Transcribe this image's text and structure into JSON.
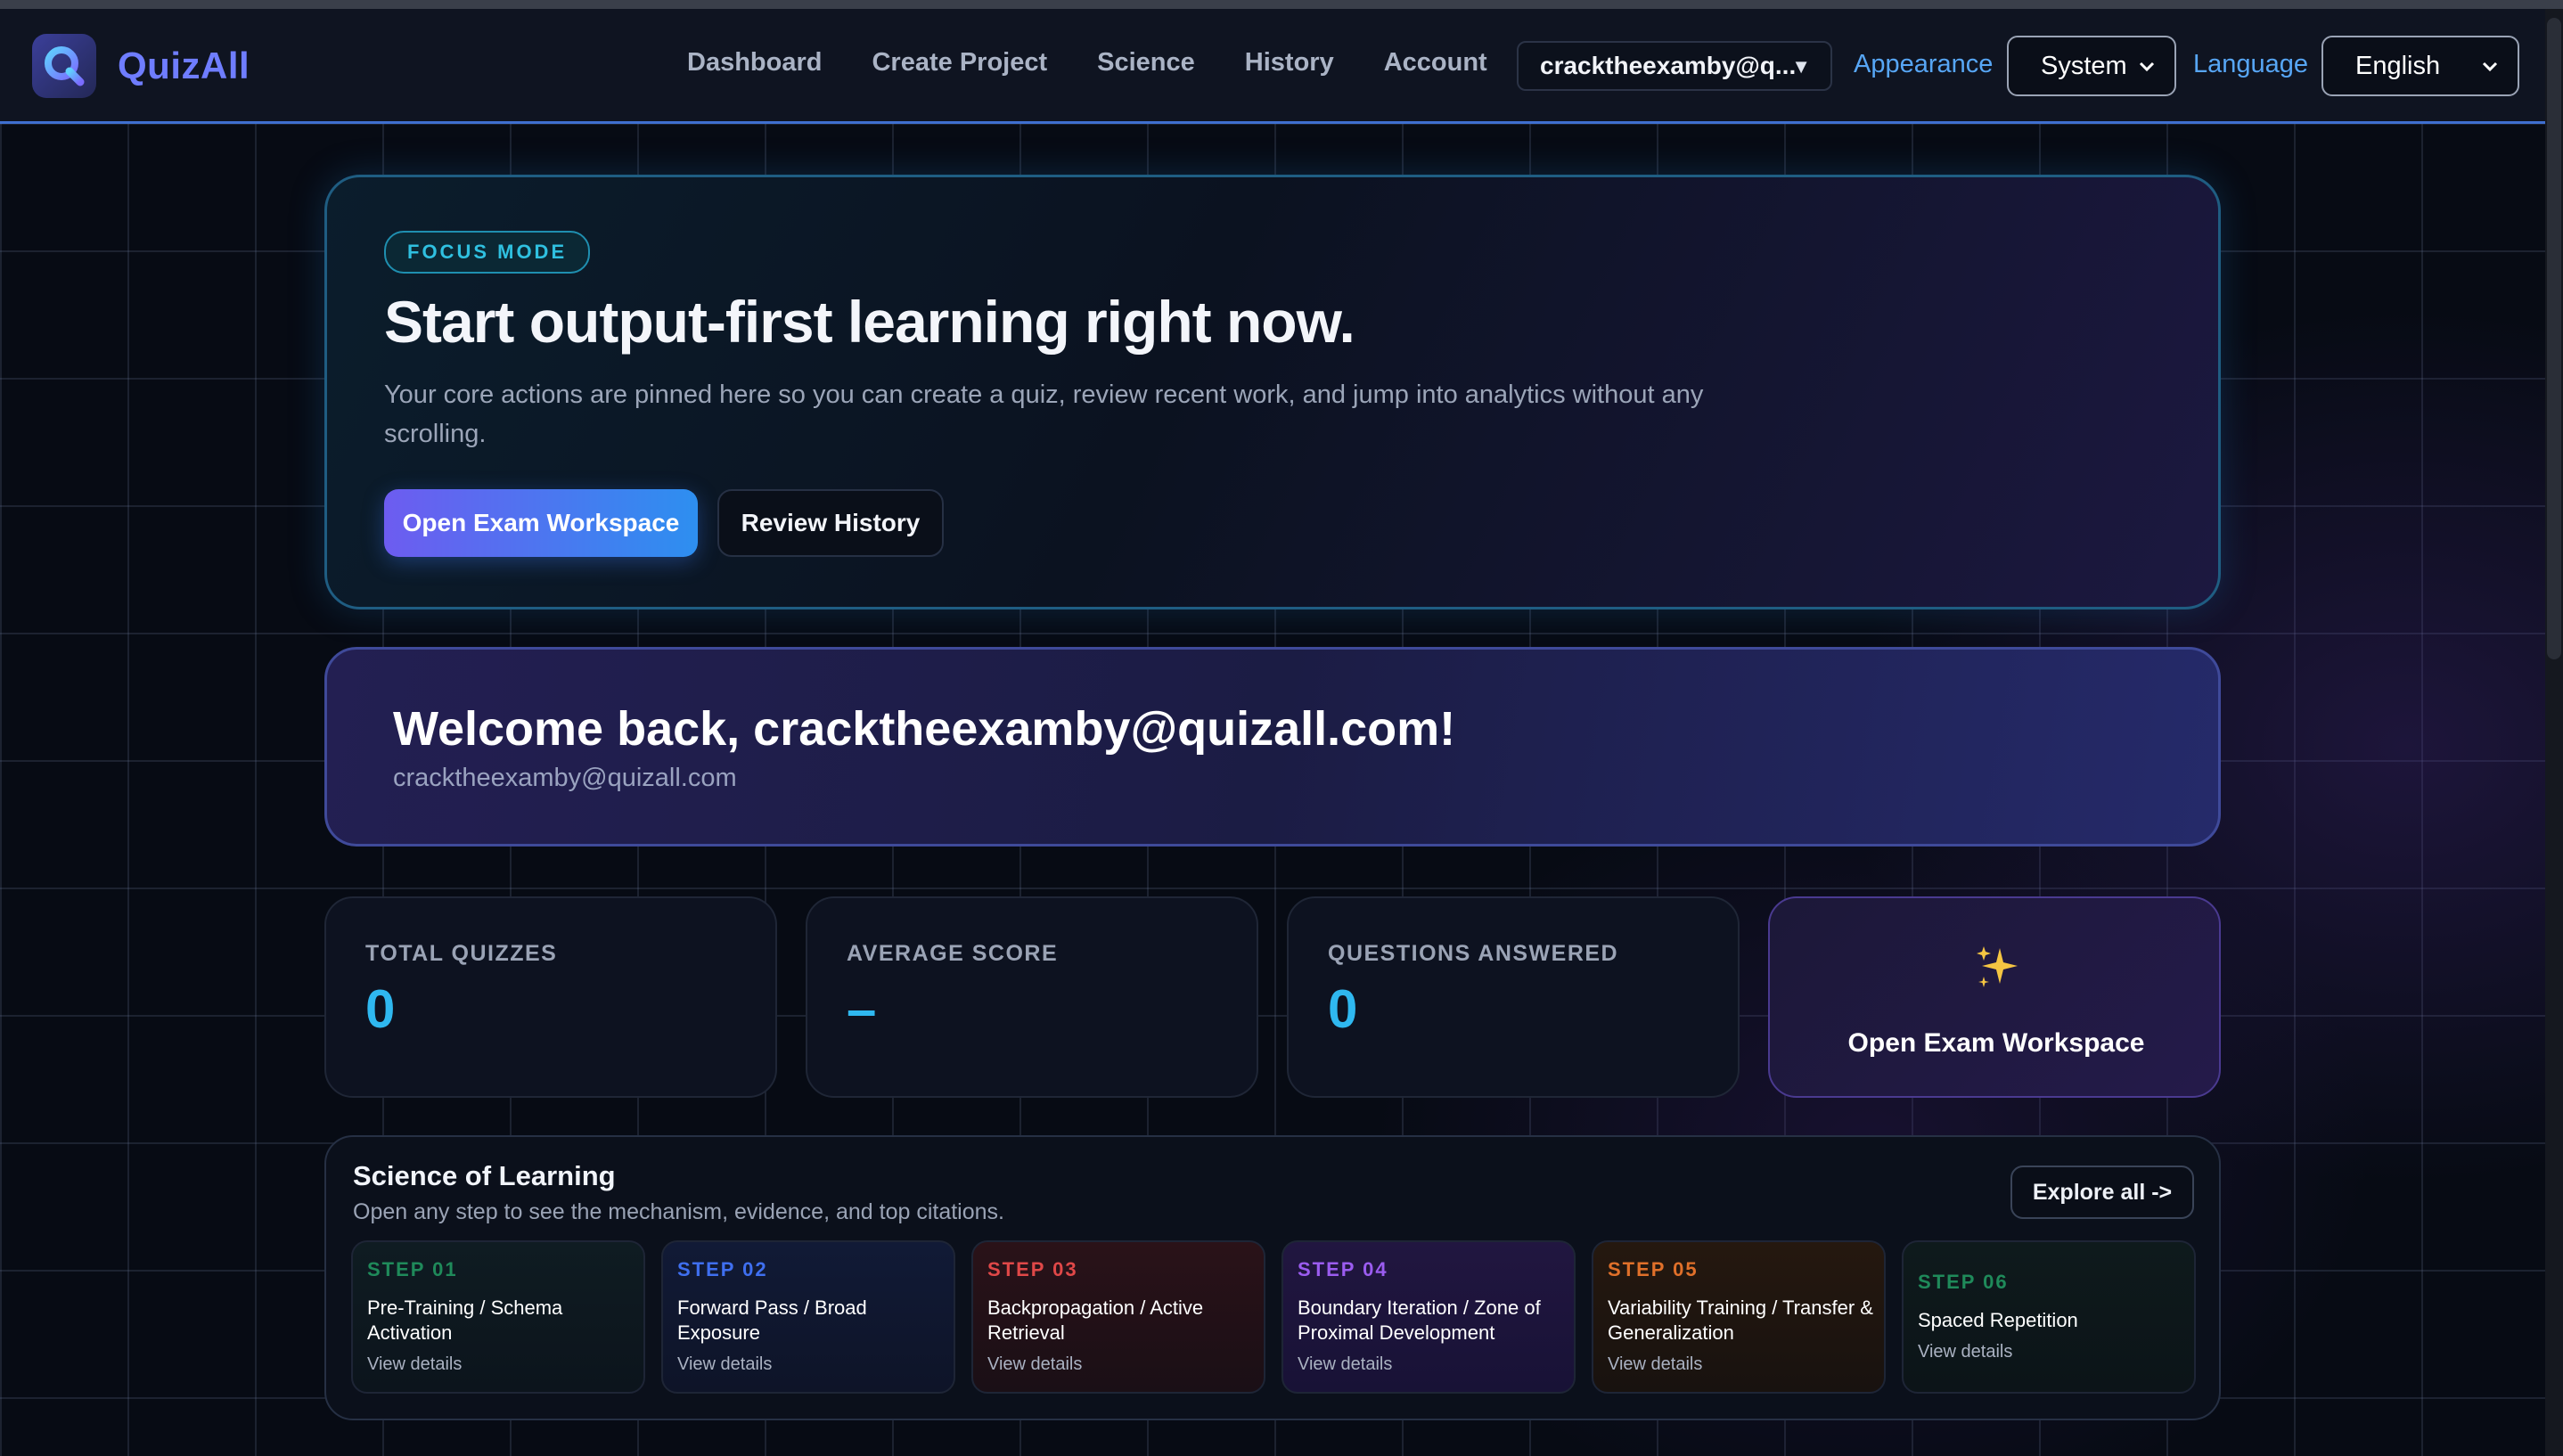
{
  "app": {
    "name": "QuizAll"
  },
  "nav": {
    "items": [
      {
        "label": "Dashboard"
      },
      {
        "label": "Create Project"
      },
      {
        "label": "Science"
      },
      {
        "label": "History"
      },
      {
        "label": "Account"
      }
    ]
  },
  "header": {
    "user_select": "cracktheexamby@q...",
    "appearance_label": "Appearance",
    "appearance_value": "System",
    "language_label": "Language",
    "language_value": "English"
  },
  "hero": {
    "badge": "FOCUS MODE",
    "title": "Start output-first learning right now.",
    "description": "Your core actions are pinned here so you can create a quiz, review recent work, and jump into analytics without any scrolling.",
    "primary_button": "Open Exam Workspace",
    "secondary_button": "Review History"
  },
  "welcome": {
    "title": "Welcome back, cracktheexamby@quizall.com!",
    "email": "cracktheexamby@quizall.com"
  },
  "stats": [
    {
      "label": "TOTAL QUIZZES",
      "value": "0"
    },
    {
      "label": "AVERAGE SCORE",
      "value": "–"
    },
    {
      "label": "QUESTIONS ANSWERED",
      "value": "0"
    }
  ],
  "stat_cta": {
    "label": "Open Exam Workspace",
    "icon": "sparkles-icon"
  },
  "science": {
    "title": "Science of Learning",
    "subtitle": "Open any step to see the mechanism, evidence, and top citations.",
    "explore": "Explore all ->",
    "steps": [
      {
        "step": "STEP 01",
        "title": "Pre-Training / Schema Activation",
        "details": "View details",
        "color": "#1f8a5a"
      },
      {
        "step": "STEP 02",
        "title": "Forward Pass / Broad Exposure",
        "details": "View details",
        "color": "#3f6ff0"
      },
      {
        "step": "STEP 03",
        "title": "Backpropagation / Active Retrieval",
        "details": "View details",
        "color": "#e04848"
      },
      {
        "step": "STEP 04",
        "title": "Boundary Iteration / Zone of Proximal Development",
        "details": "View details",
        "color": "#9b5cf0"
      },
      {
        "step": "STEP 05",
        "title": "Variability Training / Transfer & Generalization",
        "details": "View details",
        "color": "#e0702a"
      },
      {
        "step": "STEP 06",
        "title": "Spaced Repetition",
        "details": "View details",
        "color": "#1f8a5a"
      }
    ]
  }
}
